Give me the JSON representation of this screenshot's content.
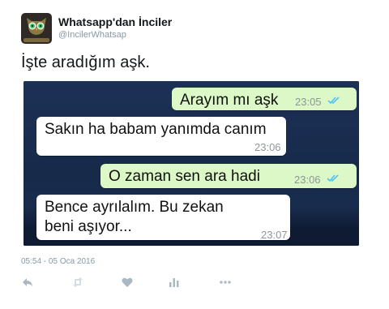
{
  "account": {
    "display_name": "Whatsapp'dan İnciler",
    "handle": "@IncilerWhatsap"
  },
  "tweet": {
    "text": "İşte aradığım aşk.",
    "timestamp": "05:54 - 05 Oca 2016"
  },
  "chat": {
    "messages": [
      {
        "direction": "out",
        "text": "Arayım mı aşk",
        "time": "23:05",
        "read": true
      },
      {
        "direction": "in",
        "text": "Sakın ha babam yanımda canım",
        "time": "23:06"
      },
      {
        "direction": "out",
        "text": "O zaman sen ara hadi",
        "time": "23:06",
        "read": true
      },
      {
        "direction": "in",
        "text": "Bence ayrılalım. Bu zekan beni aşıyor...",
        "time": "23:07"
      }
    ],
    "colors": {
      "outgoing": "#dcf8c6",
      "incoming": "#ffffff",
      "read_ticks": "#4fc3f7",
      "background": "#1a2d50"
    }
  },
  "actions": {
    "icons": [
      "reply-icon",
      "retweet-icon",
      "like-icon",
      "analytics-icon",
      "more-icon"
    ]
  }
}
